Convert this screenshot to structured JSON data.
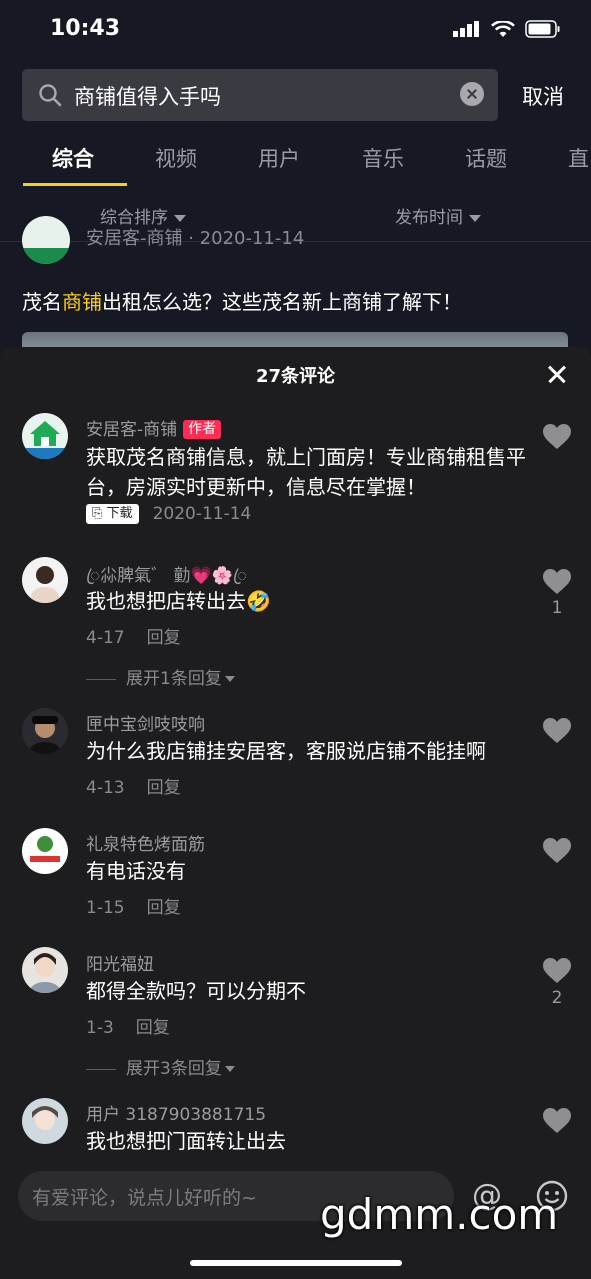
{
  "status_bar": {
    "time": "10:43"
  },
  "search": {
    "query": "商铺值得入手吗",
    "cancel_label": "取消"
  },
  "tabs": [
    "综合",
    "视频",
    "用户",
    "音乐",
    "话题",
    "直"
  ],
  "sort": {
    "left": "综合排序",
    "right": "发布时间"
  },
  "post": {
    "author_partial": "安居客-商铺 · 2020-11-14",
    "title_before": "茂名",
    "title_highlight": "商铺",
    "title_after": "出租怎么选？这些茂名新上商铺了解下！"
  },
  "comments_sheet": {
    "title": "27条评论",
    "comments": [
      {
        "username": "安居客-商铺",
        "badge": "作者",
        "text": "获取茂名商铺信息，就上门面房！专业商铺租售平台，房源实时更新中，信息尽在掌握！",
        "download_label": "下载",
        "date": "2020-11-14",
        "likes": ""
      },
      {
        "username": "ꦿ尛脾氣゛ 勭💗🌸ꦿ",
        "text": "我也想把店转出去🤣",
        "date": "4-17",
        "reply_label": "回复",
        "likes": "1",
        "expand": "展开1条回复"
      },
      {
        "username": "匣中宝剑吱吱响",
        "text": "为什么我店铺挂安居客，客服说店铺不能挂啊",
        "date": "4-13",
        "reply_label": "回复",
        "likes": ""
      },
      {
        "username": "礼泉特色烤面筋",
        "text": "有电话没有",
        "date": "1-15",
        "reply_label": "回复",
        "likes": ""
      },
      {
        "username": "阳光福妞",
        "text": "都得全款吗？可以分期不",
        "date": "1-3",
        "reply_label": "回复",
        "likes": "2",
        "expand": "展开3条回复"
      },
      {
        "username": "用户 3187903881715",
        "text": "我也想把门面转让出去",
        "likes": ""
      }
    ]
  },
  "input": {
    "placeholder": "有爱评论，说点儿好听的~"
  },
  "watermark": "gdmm.com",
  "colors": {
    "background": "#161823",
    "sheet": "#1d1d1f",
    "highlight": "#face15",
    "author_badge": "#fe2c55"
  }
}
